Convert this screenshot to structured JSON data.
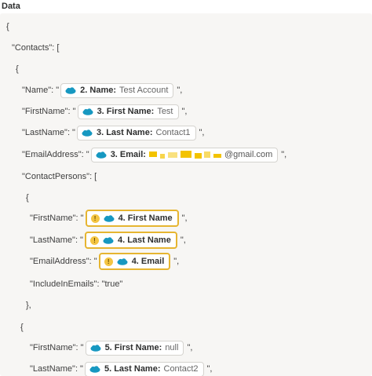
{
  "section": {
    "label": "Data"
  },
  "json_lines": {
    "open_brace": "{",
    "contacts_key": "\"Contacts\": [",
    "contact_open": "{",
    "persons_key": "\"ContactPersons\": [",
    "person_open": "{",
    "include_emails": "\"IncludeInEmails\": \"true\"",
    "person_close": "},",
    "person2_open": "{"
  },
  "fields": [
    {
      "key": "\"Name\": \"",
      "step": "2. Name:",
      "value": "Test Account",
      "suffix": "\","
    },
    {
      "key": "\"FirstName\": \"",
      "step": "3. First Name:",
      "value": "Test",
      "suffix": "\","
    },
    {
      "key": "\"LastName\": \"",
      "step": "3. Last Name:",
      "value": "Contact1",
      "suffix": "\","
    },
    {
      "key": "\"EmailAddress\": \"",
      "step": "3. Email:",
      "value": "@gmail.com",
      "suffix": "\","
    },
    {
      "key": "\"FirstName\": \"",
      "step": "4. First Name",
      "value": "",
      "suffix": "\","
    },
    {
      "key": "\"LastName\": \"",
      "step": "4. Last Name",
      "value": "",
      "suffix": "\","
    },
    {
      "key": "\"EmailAddress\": \"",
      "step": "4. Email",
      "value": "",
      "suffix": "\","
    },
    {
      "key": "\"FirstName\": \"",
      "step": "5. First Name:",
      "value": "null",
      "suffix": "\","
    },
    {
      "key": "\"LastName\": \"",
      "step": "5. Last Name:",
      "value": "Contact2",
      "suffix": "\","
    }
  ],
  "colors": {
    "salesforce": "#1798c1",
    "warning_border": "#e6b531",
    "warning_fill": "#f4c542",
    "redaction": "#f3c300"
  },
  "icons": {
    "app": "salesforce-cloud-icon",
    "warning": "warning-icon"
  }
}
